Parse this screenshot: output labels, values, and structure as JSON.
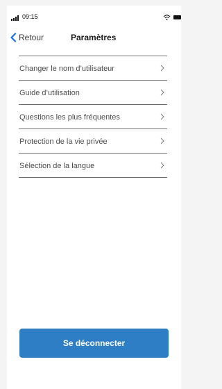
{
  "status_bar": {
    "time": "09:15",
    "signal_icon": "signal-icon",
    "wifi_icon": "wifi-icon",
    "battery_icon": "battery-icon"
  },
  "nav": {
    "back_label": "Retour",
    "title": "Paramètres",
    "accent_color": "#1a73e8"
  },
  "settings": {
    "items": [
      {
        "label": "Changer le nom d’utilisateur"
      },
      {
        "label": "Guide d’utilisation"
      },
      {
        "label": "Questions les plus fréquentes"
      },
      {
        "label": "Protection de la vie privée"
      },
      {
        "label": "Sélection de la langue"
      }
    ]
  },
  "logout": {
    "label": "Se déconnecter",
    "color": "#2e7ec6"
  }
}
